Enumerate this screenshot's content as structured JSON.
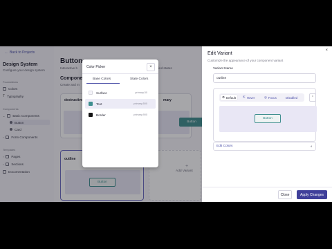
{
  "sidebar": {
    "back": "Back to Projects",
    "title": "Design System",
    "subtitle": "Configure your design system",
    "foundations_label": "Foundations",
    "foundations": [
      "Colors",
      "Typography"
    ],
    "components_label": "Components",
    "basic_components": "Basic Components",
    "basic_children": [
      "Button",
      "Card"
    ],
    "form_components": "Form Components",
    "templates_label": "Templates",
    "templates": [
      "Pages",
      "Sections",
      "Documentation"
    ]
  },
  "main": {
    "title": "Button",
    "description": "Interactive b",
    "description_right": "ind states",
    "components_heading": "Compone",
    "components_sub": "Create and m",
    "card_destructive": "destructive",
    "card_primary_partial": "mary",
    "card_outline": "outline",
    "button_label": "Button",
    "add_variant": "Add Variant"
  },
  "color_picker": {
    "title": "Color Picker",
    "close": "×",
    "tabs": [
      "Base Colors",
      "State Colors"
    ],
    "rows": [
      {
        "name": "Surface",
        "value": "primary.50",
        "swatch": "#f4f3f8"
      },
      {
        "name": "Text",
        "value": "primary.500",
        "swatch": "#3f8f8f"
      },
      {
        "name": "Border",
        "value": "primary.900",
        "swatch": "#141414"
      }
    ]
  },
  "panel": {
    "title": "Edit Variant",
    "subtitle": "Customize the appearance of your component variant",
    "name_label": "Variant Name",
    "name_value": "outline",
    "states": [
      "Default",
      "Hover",
      "Focus",
      "Disabled"
    ],
    "preview_button": "Button",
    "edit_colors": "Edit Colors",
    "close_button": "Close",
    "apply_button": "Apply Changes"
  },
  "colors": {
    "accent": "#3f3f9a",
    "teal": "#3f8f8f"
  }
}
